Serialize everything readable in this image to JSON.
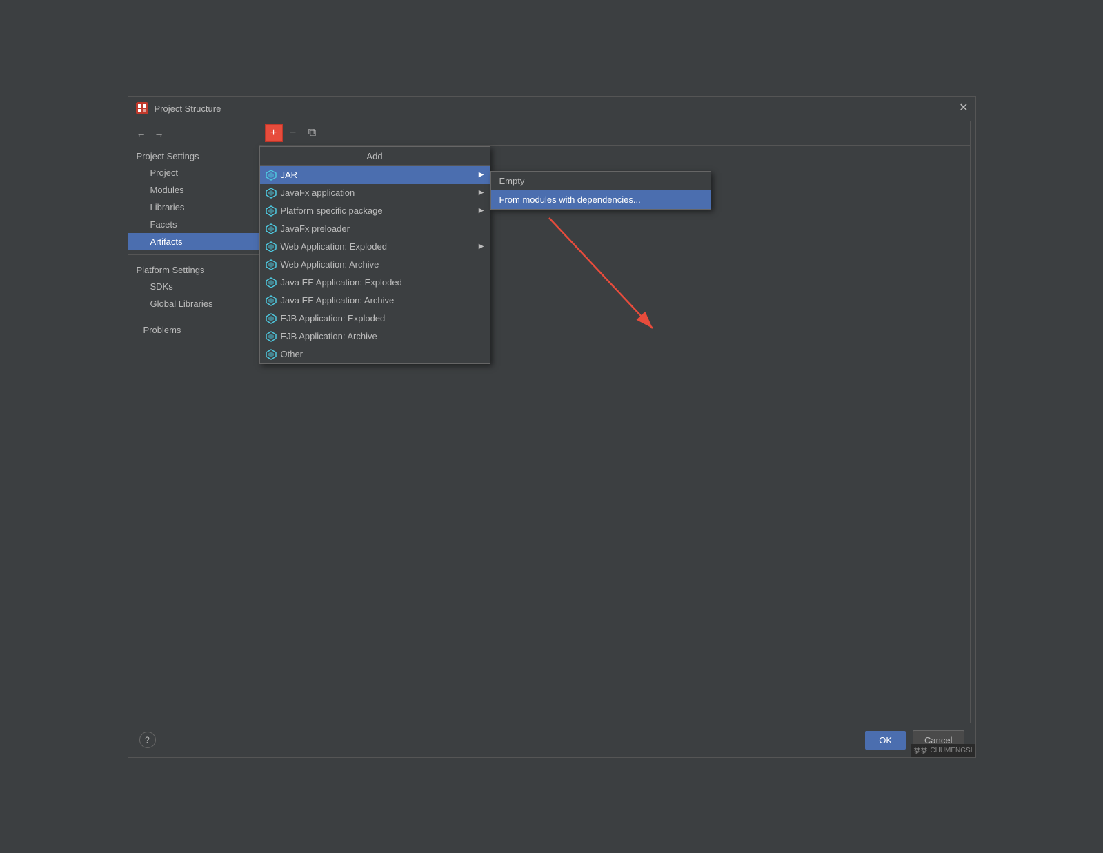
{
  "dialog": {
    "title": "Project Structure",
    "close_label": "✕"
  },
  "sidebar": {
    "nav": {
      "back_label": "←",
      "forward_label": "→"
    },
    "project_settings_label": "Project Settings",
    "items": [
      {
        "id": "project",
        "label": "Project",
        "indent": true,
        "active": false
      },
      {
        "id": "modules",
        "label": "Modules",
        "indent": true,
        "active": false
      },
      {
        "id": "libraries",
        "label": "Libraries",
        "indent": true,
        "active": false
      },
      {
        "id": "facets",
        "label": "Facets",
        "indent": true,
        "active": false
      },
      {
        "id": "artifacts",
        "label": "Artifacts",
        "indent": true,
        "active": true
      }
    ],
    "platform_settings_label": "Platform Settings",
    "platform_items": [
      {
        "id": "sdks",
        "label": "SDKs",
        "indent": true,
        "active": false
      },
      {
        "id": "global-libraries",
        "label": "Global Libraries",
        "indent": true,
        "active": false
      }
    ],
    "problems_label": "Problems"
  },
  "toolbar": {
    "add_label": "+",
    "minus_label": "−",
    "copy_label": "⧉"
  },
  "add_menu": {
    "header": "Add",
    "items": [
      {
        "id": "jar",
        "label": "JAR",
        "has_arrow": true,
        "active": true
      },
      {
        "id": "javafx-app",
        "label": "JavaFx application",
        "has_arrow": true,
        "active": false
      },
      {
        "id": "platform-pkg",
        "label": "Platform specific package",
        "has_arrow": true,
        "active": false
      },
      {
        "id": "javafx-preloader",
        "label": "JavaFx preloader",
        "has_arrow": false,
        "active": false
      },
      {
        "id": "web-app-exploded",
        "label": "Web Application: Exploded",
        "has_arrow": true,
        "active": false
      },
      {
        "id": "web-app-archive",
        "label": "Web Application: Archive",
        "has_arrow": false,
        "active": false
      },
      {
        "id": "javaee-exploded",
        "label": "Java EE Application: Exploded",
        "has_arrow": false,
        "active": false
      },
      {
        "id": "javaee-archive",
        "label": "Java EE Application: Archive",
        "has_arrow": false,
        "active": false
      },
      {
        "id": "ejb-exploded",
        "label": "EJB Application: Exploded",
        "has_arrow": false,
        "active": false
      },
      {
        "id": "ejb-archive",
        "label": "EJB Application: Archive",
        "has_arrow": false,
        "active": false
      },
      {
        "id": "other",
        "label": "Other",
        "has_arrow": false,
        "active": false
      }
    ]
  },
  "jar_submenu": {
    "items": [
      {
        "id": "empty",
        "label": "Empty",
        "highlighted": false
      },
      {
        "id": "from-modules",
        "label": "From modules with dependencies...",
        "highlighted": true
      }
    ]
  },
  "bottom_bar": {
    "ok_label": "OK",
    "cancel_label": "Cancel",
    "help_label": "?"
  },
  "watermark": {
    "text": "梦梦",
    "sub": "CHUMENGSI"
  }
}
